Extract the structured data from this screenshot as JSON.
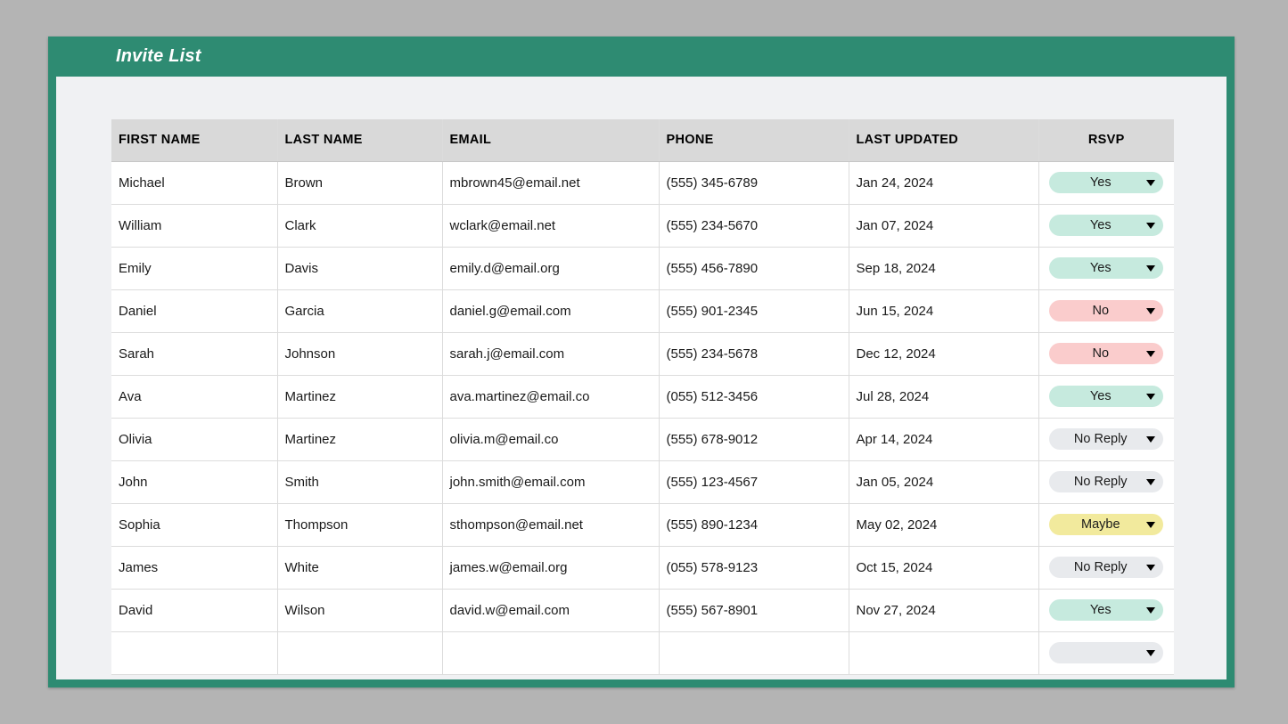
{
  "window": {
    "title": "Invite List",
    "accent_color": "#2e8b72",
    "page_background": "#b4b4b4",
    "sheet_background": "#f0f1f3"
  },
  "table": {
    "headers": [
      "FIRST NAME",
      "LAST NAME",
      "EMAIL",
      "PHONE",
      "LAST UPDATED",
      "RSVP"
    ],
    "header_background": "#d9d9d9",
    "rows": [
      {
        "first_name": "Michael",
        "last_name": "Brown",
        "email": "mbrown45@email.net",
        "phone": "(555) 345-6789",
        "last_updated": "Jan 24, 2024",
        "rsvp": "Yes",
        "rsvp_state": "yes",
        "rsvp_color": "#c6eade"
      },
      {
        "first_name": "William",
        "last_name": "Clark",
        "email": "wclark@email.net",
        "phone": "(555) 234-5670",
        "last_updated": "Jan 07, 2024",
        "rsvp": "Yes",
        "rsvp_state": "yes",
        "rsvp_color": "#c6eade"
      },
      {
        "first_name": "Emily",
        "last_name": "Davis",
        "email": "emily.d@email.org",
        "phone": "(555) 456-7890",
        "last_updated": "Sep 18, 2024",
        "rsvp": "Yes",
        "rsvp_state": "yes",
        "rsvp_color": "#c6eade"
      },
      {
        "first_name": "Daniel",
        "last_name": "Garcia",
        "email": "daniel.g@email.com",
        "phone": "(555) 901-2345",
        "last_updated": "Jun 15, 2024",
        "rsvp": "No",
        "rsvp_state": "no",
        "rsvp_color": "#facccc"
      },
      {
        "first_name": "Sarah",
        "last_name": "Johnson",
        "email": "sarah.j@email.com",
        "phone": "(555) 234-5678",
        "last_updated": "Dec 12, 2024",
        "rsvp": "No",
        "rsvp_state": "no",
        "rsvp_color": "#facccc"
      },
      {
        "first_name": "Ava",
        "last_name": "Martinez",
        "email": "ava.martinez@email.co",
        "phone": "(055) 512-3456",
        "last_updated": "Jul 28, 2024",
        "rsvp": "Yes",
        "rsvp_state": "yes",
        "rsvp_color": "#c6eade"
      },
      {
        "first_name": "Olivia",
        "last_name": "Martinez",
        "email": "olivia.m@email.co",
        "phone": "(555) 678-9012",
        "last_updated": "Apr 14, 2024",
        "rsvp": "No Reply",
        "rsvp_state": "noreply",
        "rsvp_color": "#e8eaed"
      },
      {
        "first_name": "John",
        "last_name": "Smith",
        "email": "john.smith@email.com",
        "phone": "(555) 123-4567",
        "last_updated": "Jan 05, 2024",
        "rsvp": "No Reply",
        "rsvp_state": "noreply",
        "rsvp_color": "#e8eaed"
      },
      {
        "first_name": "Sophia",
        "last_name": "Thompson",
        "email": "sthompson@email.net",
        "phone": "(555) 890-1234",
        "last_updated": "May 02, 2024",
        "rsvp": "Maybe",
        "rsvp_state": "maybe",
        "rsvp_color": "#f2ea9d"
      },
      {
        "first_name": "James",
        "last_name": "White",
        "email": "james.w@email.org",
        "phone": "(055) 578-9123",
        "last_updated": "Oct 15, 2024",
        "rsvp": "No Reply",
        "rsvp_state": "noreply",
        "rsvp_color": "#e8eaed"
      },
      {
        "first_name": "David",
        "last_name": "Wilson",
        "email": "david.w@email.com",
        "phone": "(555) 567-8901",
        "last_updated": "Nov 27, 2024",
        "rsvp": "Yes",
        "rsvp_state": "yes",
        "rsvp_color": "#c6eade"
      },
      {
        "first_name": "",
        "last_name": "",
        "email": "",
        "phone": "",
        "last_updated": "",
        "rsvp": "",
        "rsvp_state": "blank",
        "rsvp_color": "#e8eaed"
      }
    ]
  }
}
